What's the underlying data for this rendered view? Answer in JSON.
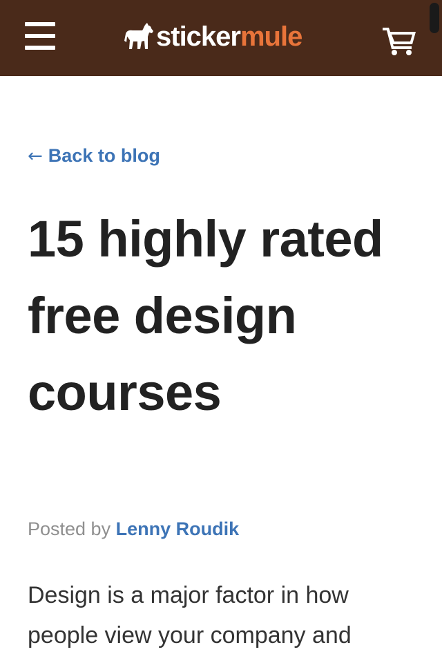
{
  "header": {
    "logo_part1": "sticker",
    "logo_part2": "mule",
    "background_color": "#4a2a1a",
    "accent_color": "#e8743a",
    "menu_icon": "hamburger-menu-icon",
    "cart_icon": "shopping-cart-icon"
  },
  "article": {
    "back_link_arrow": "←",
    "back_link_label": "Back to blog",
    "title": "15 highly rated free design courses",
    "posted_by_label": "Posted by",
    "author": "Lenny Roudik",
    "body_excerpt": "Design is a major factor in how people view your company and",
    "link_color": "#3d74b6"
  }
}
